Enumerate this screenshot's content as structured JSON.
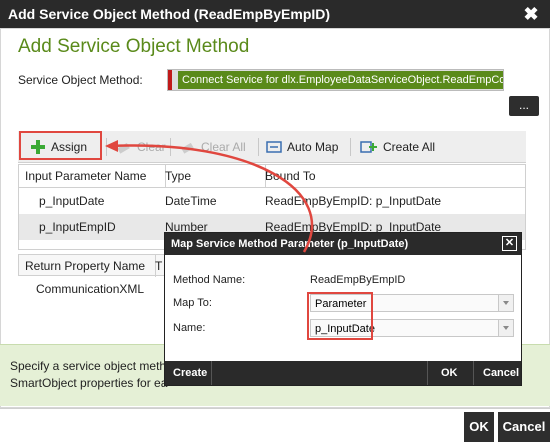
{
  "window": {
    "title": "Add Service Object Method (ReadEmpByEmpID)"
  },
  "heading": "Add Service Object Method",
  "service_object_method": {
    "label": "Service Object Method:",
    "value": "Connect Service for dlx.EmployeeDataServiceObject.ReadEmpCo",
    "browse_label": "..."
  },
  "toolbar": {
    "assign": "Assign",
    "clear": "Clear",
    "clear_all": "Clear All",
    "auto_map": "Auto Map",
    "create_all": "Create All"
  },
  "input_table": {
    "headers": [
      "Input Parameter Name",
      "Type",
      "Bound To"
    ],
    "rows": [
      [
        "p_InputDate",
        "DateTime",
        "ReadEmpByEmpID: p_InputDate"
      ],
      [
        "p_InputEmpID",
        "Number",
        "ReadEmpByEmpID: p_InputDate"
      ]
    ]
  },
  "return_table": {
    "headers": [
      "Return Property Name",
      "T"
    ],
    "rows": [
      [
        "CommunicationXML"
      ]
    ]
  },
  "help_text": {
    "line1": "Specify a service object meth",
    "line2": "SmartObject properties for ea"
  },
  "footer": {
    "ok": "OK",
    "cancel": "Cancel"
  },
  "map_dialog": {
    "title": "Map Service Method Parameter (p_InputDate)",
    "method_name_label": "Method Name:",
    "method_name_value": "ReadEmpByEmpID",
    "map_to_label": "Map To:",
    "map_to_value": "Parameter",
    "name_label": "Name:",
    "name_value": "p_InputDate",
    "create": "Create",
    "ok": "OK",
    "cancel": "Cancel"
  },
  "colors": {
    "heading_green": "#5a8a1a",
    "highlight_red": "#e0473f",
    "dark": "#2a2a2a"
  }
}
